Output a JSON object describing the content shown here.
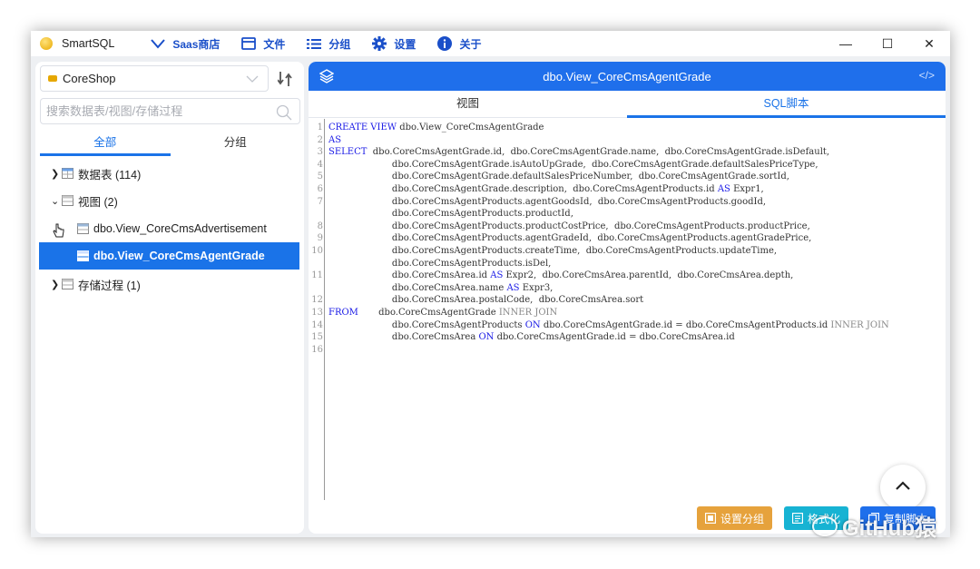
{
  "app": {
    "name": "SmartSQL"
  },
  "menu": [
    {
      "label": "Saas商店",
      "icon": "chevron-down-icon"
    },
    {
      "label": "文件",
      "icon": "folder-icon"
    },
    {
      "label": "分组",
      "icon": "list-icon"
    },
    {
      "label": "设置",
      "icon": "gear-icon"
    },
    {
      "label": "关于",
      "icon": "info-icon"
    }
  ],
  "window_controls": {
    "minimize": "—",
    "maximize": "☐",
    "close": "✕"
  },
  "left": {
    "database": "CoreShop",
    "search_placeholder": "搜索数据表/视图/存储过程",
    "tabs": [
      "全部",
      "分组"
    ],
    "tree": [
      {
        "label": "数据表 (114)",
        "expanded": false
      },
      {
        "label": "视图 (2)",
        "expanded": true
      },
      {
        "label": "dbo.View_CoreCmsAdvertisement"
      },
      {
        "label": "dbo.View_CoreCmsAgentGrade",
        "selected": true
      },
      {
        "label": "存储过程 (1)",
        "expanded": false
      }
    ]
  },
  "right": {
    "title": "dbo.View_CoreCmsAgentGrade",
    "tabs": [
      "视图",
      "SQL脚本"
    ],
    "active_tab": "SQL脚本",
    "code": [
      {
        "ln": "1",
        "parts": [
          [
            "kw",
            "CREATE VIEW"
          ],
          [
            "t",
            " dbo.View_CoreCmsAgentGrade"
          ]
        ]
      },
      {
        "ln": "2",
        "parts": [
          [
            "kw",
            "AS"
          ]
        ]
      },
      {
        "ln": "3",
        "parts": [
          [
            "kw",
            "SELECT"
          ],
          [
            "t",
            "  dbo.CoreCmsAgentGrade.id,  dbo.CoreCmsAgentGrade.name,  dbo.CoreCmsAgentGrade.isDefault,"
          ]
        ]
      },
      {
        "ln": "4",
        "parts": [
          [
            "t",
            "                      dbo.CoreCmsAgentGrade.isAutoUpGrade,  dbo.CoreCmsAgentGrade.defaultSalesPriceType,"
          ]
        ]
      },
      {
        "ln": "5",
        "parts": [
          [
            "t",
            "                      dbo.CoreCmsAgentGrade.defaultSalesPriceNumber,  dbo.CoreCmsAgentGrade.sortId,"
          ]
        ]
      },
      {
        "ln": "6",
        "parts": [
          [
            "t",
            "                      dbo.CoreCmsAgentGrade.description,  dbo.CoreCmsAgentProducts.id "
          ],
          [
            "kw",
            "AS"
          ],
          [
            "t",
            " Expr1,"
          ]
        ]
      },
      {
        "ln": "7",
        "parts": [
          [
            "t",
            "                      dbo.CoreCmsAgentProducts.agentGoodsId,  dbo.CoreCmsAgentProducts.goodId,"
          ]
        ]
      },
      {
        "ln": "",
        "parts": [
          [
            "t",
            "                      dbo.CoreCmsAgentProducts.productId,"
          ]
        ]
      },
      {
        "ln": "8",
        "parts": [
          [
            "t",
            "                      dbo.CoreCmsAgentProducts.productCostPrice,  dbo.CoreCmsAgentProducts.productPrice,"
          ]
        ]
      },
      {
        "ln": "9",
        "parts": [
          [
            "t",
            "                      dbo.CoreCmsAgentProducts.agentGradeId,  dbo.CoreCmsAgentProducts.agentGradePrice,"
          ]
        ]
      },
      {
        "ln": "10",
        "parts": [
          [
            "t",
            "                      dbo.CoreCmsAgentProducts.createTime,  dbo.CoreCmsAgentProducts.updateTime,"
          ]
        ]
      },
      {
        "ln": "",
        "parts": [
          [
            "t",
            "                      dbo.CoreCmsAgentProducts.isDel,"
          ]
        ]
      },
      {
        "ln": "11",
        "parts": [
          [
            "t",
            "                      dbo.CoreCmsArea.id "
          ],
          [
            "kw",
            "AS"
          ],
          [
            "t",
            " Expr2,  dbo.CoreCmsArea.parentId,  dbo.CoreCmsArea.depth,"
          ]
        ]
      },
      {
        "ln": "",
        "parts": [
          [
            "t",
            "                      dbo.CoreCmsArea.name "
          ],
          [
            "kw",
            "AS"
          ],
          [
            "t",
            " Expr3,"
          ]
        ]
      },
      {
        "ln": "12",
        "parts": [
          [
            "t",
            "                      dbo.CoreCmsArea.postalCode,  dbo.CoreCmsArea.sort"
          ]
        ]
      },
      {
        "ln": "13",
        "parts": [
          [
            "kw",
            "FROM"
          ],
          [
            "t",
            "       dbo.CoreCmsAgentGrade "
          ],
          [
            "kw2",
            "INNER JOIN"
          ]
        ]
      },
      {
        "ln": "14",
        "parts": [
          [
            "t",
            "                      dbo.CoreCmsAgentProducts "
          ],
          [
            "kw",
            "ON"
          ],
          [
            "t",
            " dbo.CoreCmsAgentGrade.id = dbo.CoreCmsAgentProducts.id "
          ],
          [
            "kw2",
            "INNER JOIN"
          ]
        ]
      },
      {
        "ln": "15",
        "parts": [
          [
            "t",
            "                      dbo.CoreCmsArea "
          ],
          [
            "kw",
            "ON"
          ],
          [
            "t",
            " dbo.CoreCmsAgentGrade.id = dbo.CoreCmsArea.id"
          ]
        ]
      },
      {
        "ln": "16",
        "parts": []
      }
    ],
    "buttons": {
      "set_group": "设置分组",
      "format": "格式化",
      "copy_script": "复制脚本"
    }
  },
  "watermark": "GitHub猿",
  "colors": {
    "accent": "#1f6feb",
    "orange": "#e6a23c",
    "teal": "#17b3d3"
  }
}
